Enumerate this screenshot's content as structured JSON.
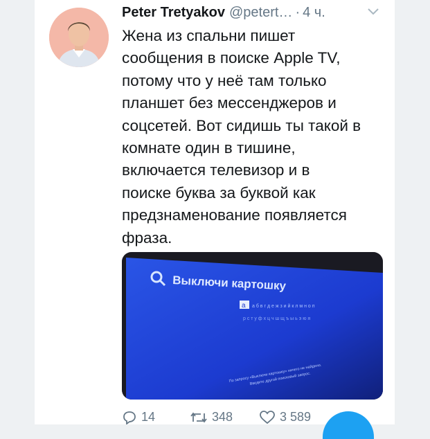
{
  "tweet": {
    "author_name": "Peter Tretyakov",
    "handle": "@petert…",
    "separator": "·",
    "time": "4 ч.",
    "text": "Жена из спальни пишет\nсообщения в поиске Apple TV,\nпотому что у неё там только\nпланшет без мессенджеров и\nсоцсетей. Вот сидишь ты такой в\nкомнате один в тишине,\nвключается телевизор и в\nпоиске буква за буквой как\nпредзнаменование появляется\nфраза."
  },
  "media": {
    "search_query": "Выключи картошку",
    "keyboard_row1": "а б в г д е ж з и й к л м н о п",
    "keyboard_row2": "р с т у ф х ц ч ш щ ъ ы ь э ю я",
    "selected_key": "а",
    "no_results_line1": "По запросу «Выключи картошку» ничего не найдено.",
    "no_results_line2": "Введите другой поисковый запрос."
  },
  "actions": {
    "replies": "14",
    "retweets": "348",
    "likes": "3 589"
  },
  "icons": {
    "reply": "reply-icon",
    "retweet": "retweet-icon",
    "like": "heart-icon",
    "menu": "chevron-down-icon"
  },
  "colors": {
    "text": "#14171a",
    "secondary": "#657786",
    "accent": "#1da1f2",
    "tv_blue": "#1c3bd0"
  }
}
